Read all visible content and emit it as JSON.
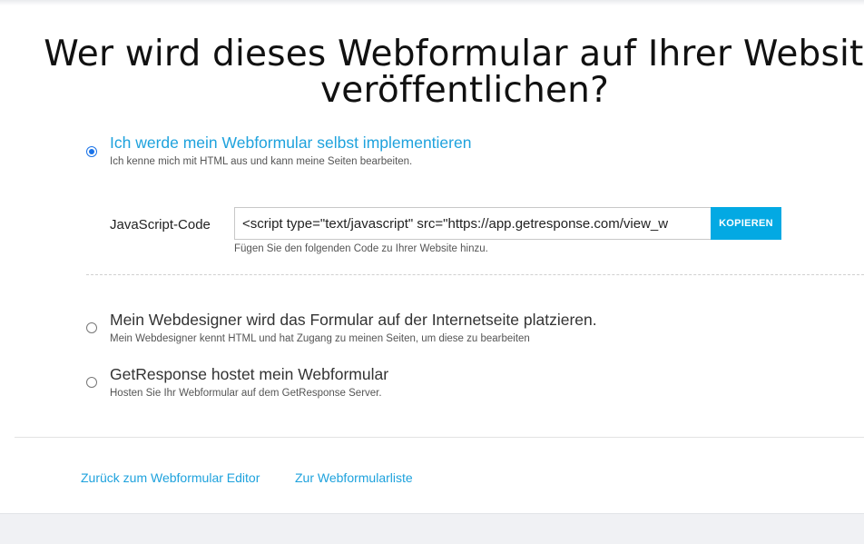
{
  "title": {
    "line1": "Wer wird dieses Webformular auf Ihrer Website",
    "line2": "veröffentlichen?"
  },
  "options": [
    {
      "label": "Ich werde mein Webformular selbst implementieren",
      "description": "Ich kenne mich mit HTML aus und kann meine Seiten bearbeiten.",
      "selected": true
    },
    {
      "label": "Mein Webdesigner wird das Formular auf der Internetseite platzieren.",
      "description": "Mein Webdesigner kennt HTML und hat Zugang zu meinen Seiten, um diese zu bearbeiten",
      "selected": false
    },
    {
      "label": "GetResponse hostet mein Webformular",
      "description": "Hosten Sie Ihr Webformular auf dem GetResponse Server.",
      "selected": false
    }
  ],
  "code": {
    "label": "JavaScript-Code",
    "value": "<script type=\"text/javascript\" src=\"https://app.getresponse.com/view_w",
    "copy_label": "KOPIEREN",
    "help": "Fügen Sie den folgenden Code zu Ihrer Website hinzu."
  },
  "links": {
    "back_editor": "Zurück zum Webformular Editor",
    "form_list": "Zur Webformularliste"
  },
  "colors": {
    "accent": "#1ea2dd",
    "button": "#03a9e3",
    "radio_selected": "#1a73e8"
  }
}
